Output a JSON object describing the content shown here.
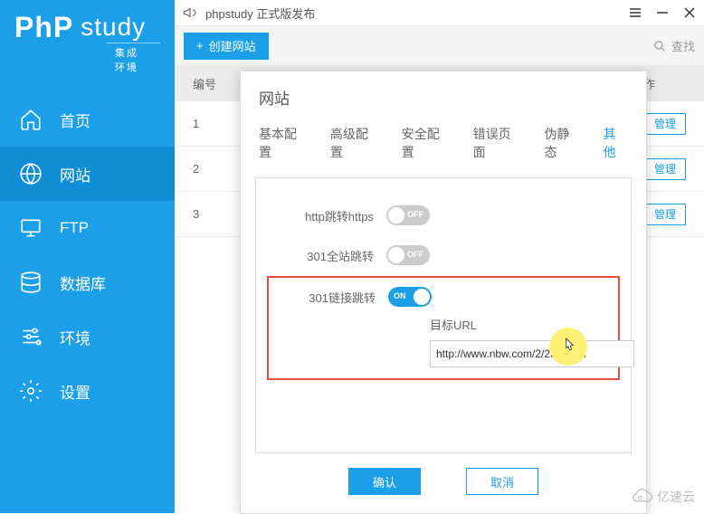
{
  "logo": {
    "brand_p": "PhP",
    "brand_s": "study",
    "sub": "集成环境"
  },
  "nav": {
    "items": [
      {
        "label": "首页"
      },
      {
        "label": "网站"
      },
      {
        "label": "FTP"
      },
      {
        "label": "数据库"
      },
      {
        "label": "环境"
      },
      {
        "label": "设置"
      }
    ]
  },
  "topbar": {
    "announce": "phpstudy 正式版发布"
  },
  "toolbar": {
    "create_label": "创建网站",
    "search_label": "查找"
  },
  "table": {
    "col_num": "编号",
    "col_op": "操作",
    "rows": [
      {
        "num": "1",
        "manage": "管理"
      },
      {
        "num": "2",
        "manage": "管理"
      },
      {
        "num": "3",
        "manage": "管理"
      }
    ]
  },
  "modal": {
    "title": "网站",
    "tabs": [
      {
        "label": "基本配置"
      },
      {
        "label": "高级配置"
      },
      {
        "label": "安全配置"
      },
      {
        "label": "错误页面"
      },
      {
        "label": "伪静态"
      },
      {
        "label": "其他"
      }
    ],
    "opts": {
      "http_https": {
        "label": "http跳转https",
        "state": "OFF"
      },
      "full_301": {
        "label": "301全站跳转",
        "state": "OFF"
      },
      "link_301": {
        "label": "301链接跳转",
        "state": "ON"
      }
    },
    "target_label": "目标URL",
    "target_value": "http://www.nbw.com/2/234.html",
    "confirm": "确认",
    "cancel": "取消"
  },
  "watermark": {
    "text": "亿速云"
  }
}
